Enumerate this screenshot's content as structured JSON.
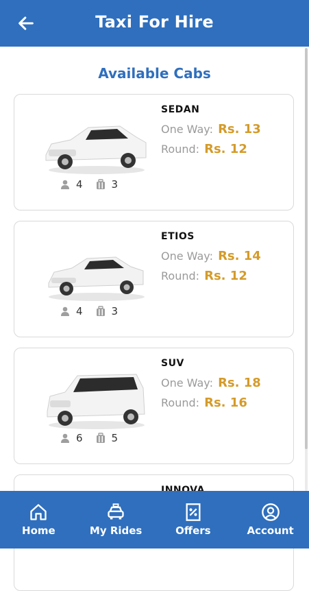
{
  "header": {
    "title": "Taxi For Hire",
    "back_icon": "arrow-left-icon",
    "color": "#2f6fbd"
  },
  "section": {
    "title": "Available Cabs"
  },
  "cabs": [
    {
      "name": "SEDAN",
      "one_way_label": "One Way:",
      "one_way_price": "Rs. 13",
      "round_label": "Round:",
      "round_price": "Rs. 12",
      "seats": "4",
      "luggage": "3"
    },
    {
      "name": "ETIOS",
      "one_way_label": "One Way:",
      "one_way_price": "Rs. 14",
      "round_label": "Round:",
      "round_price": "Rs. 12",
      "seats": "4",
      "luggage": "3"
    },
    {
      "name": "SUV",
      "one_way_label": "One Way:",
      "one_way_price": "Rs. 18",
      "round_label": "Round:",
      "round_price": "Rs. 16",
      "seats": "6",
      "luggage": "5"
    },
    {
      "name": "INNOVA"
    }
  ],
  "bottom_nav": [
    {
      "label": "Home",
      "icon": "home-icon"
    },
    {
      "label": "My Rides",
      "icon": "car-icon"
    },
    {
      "label": "Offers",
      "icon": "percent-icon"
    },
    {
      "label": "Account",
      "icon": "user-icon"
    }
  ],
  "colors": {
    "primary": "#2f6fbd",
    "price": "#d49b2a",
    "muted": "#9a9a9a"
  }
}
